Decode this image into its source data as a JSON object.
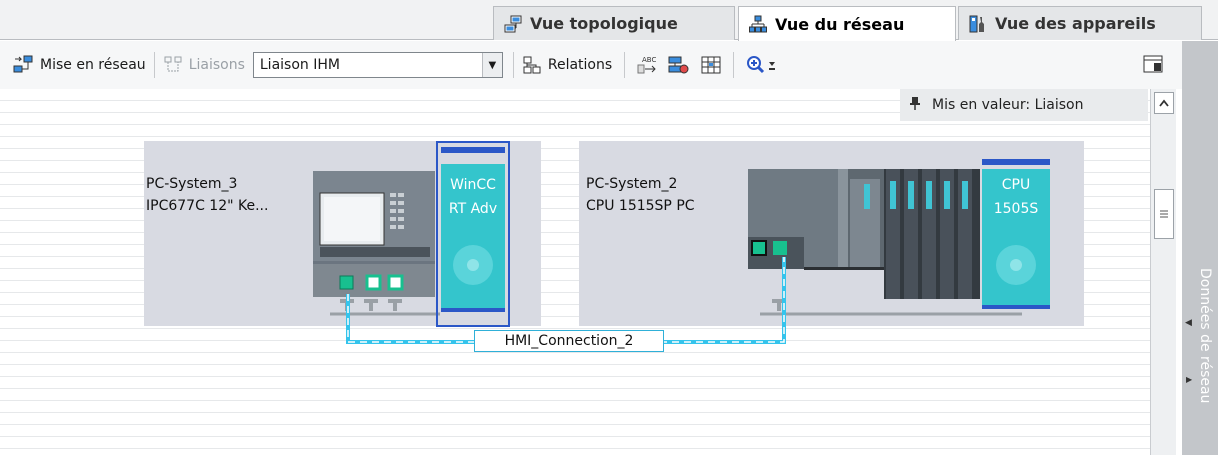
{
  "tabs": [
    {
      "label": "Vue topologique",
      "icon": "topology-view-icon",
      "active": false
    },
    {
      "label": "Vue du réseau",
      "icon": "network-view-icon",
      "active": true
    },
    {
      "label": "Vue des appareils",
      "icon": "device-view-icon",
      "active": false
    }
  ],
  "toolbar": {
    "network_label": "Mise en réseau",
    "connections_label": "Liaisons",
    "connection_type_value": "Liaison IHM",
    "relations_label": "Relations"
  },
  "highlight": {
    "text": "Mis en valeur: Liaison"
  },
  "stations": [
    {
      "name": "PC-System_3",
      "device": "IPC677C 12\" Ke...",
      "runtime_line1": "WinCC",
      "runtime_line2": "RT Adv"
    },
    {
      "name": "PC-System_2",
      "device": "CPU 1515SP PC",
      "runtime_line1": "CPU",
      "runtime_line2": "1505S"
    }
  ],
  "connection": {
    "label": "HMI_Connection_2"
  },
  "side_panel": {
    "label": "Données de réseau"
  },
  "colors": {
    "accent_cyan": "#34c5cc",
    "selection_blue": "#2b57c7",
    "connection_line": "#34c4ec",
    "station_bg": "#d8dae2"
  }
}
